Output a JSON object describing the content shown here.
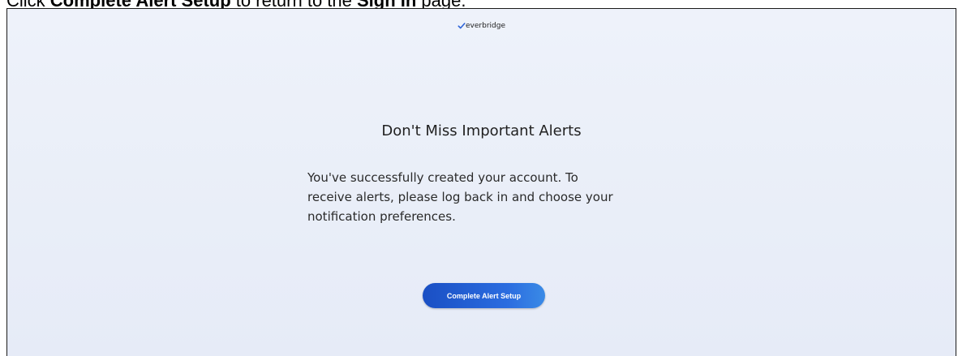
{
  "instruction": {
    "prefix": "Click ",
    "bold1": "Complete Alert Setup",
    "middle": " to return to the ",
    "bold2": "Sign In",
    "suffix": " page."
  },
  "brand": {
    "name": "everbridge",
    "check_color": "#2b62d8"
  },
  "page": {
    "title": "Don't Miss Important Alerts",
    "message_lines": [
      "You've successfully created your account. To",
      "receive alerts, please log back in and choose your",
      "notification preferences."
    ]
  },
  "actions": {
    "complete_setup_label": "Complete Alert Setup",
    "button_color": "#1f5bd1"
  }
}
